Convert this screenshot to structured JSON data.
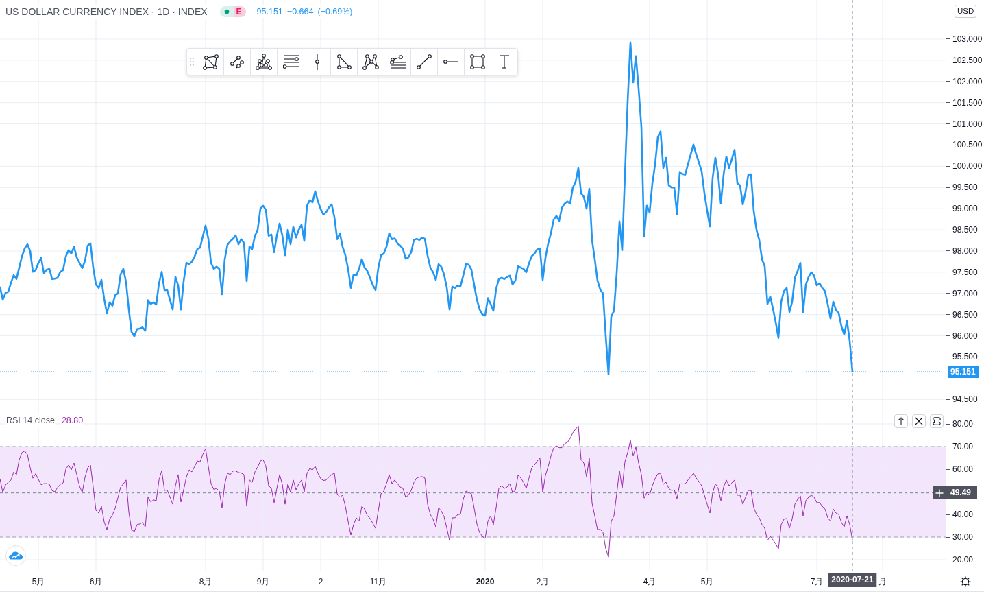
{
  "legend": {
    "title": "US DOLLAR CURRENCY INDEX · 1D · INDEX",
    "badge": "E",
    "last": "95.151",
    "change": "−0.664",
    "change_pct": "(−0.69%)"
  },
  "currency": "USD",
  "price_chart": {
    "chart_data": {
      "type": "line",
      "grid": true,
      "ylim": [
        94.278,
        103.922
      ],
      "yticks": [
        {
          "value": 94.5,
          "label": "94.500"
        },
        {
          "value": 95.5,
          "label": "95.500"
        },
        {
          "value": 96,
          "label": "96.000"
        },
        {
          "value": 96.5,
          "label": "96.500"
        },
        {
          "value": 97,
          "label": "97.000"
        },
        {
          "value": 97.5,
          "label": "97.500"
        },
        {
          "value": 98,
          "label": "98.000"
        },
        {
          "value": 98.5,
          "label": "98.500"
        },
        {
          "value": 99,
          "label": "99.000"
        },
        {
          "value": 99.5,
          "label": "99.500"
        },
        {
          "value": 100,
          "label": "100.000"
        },
        {
          "value": 100.5,
          "label": "100.500"
        },
        {
          "value": 101,
          "label": "101.000"
        },
        {
          "value": 101.5,
          "label": "101.500"
        },
        {
          "value": 102,
          "label": "102.000"
        },
        {
          "value": 102.5,
          "label": "102.500"
        },
        {
          "value": 103,
          "label": "103.000"
        }
      ],
      "categories": [
        null,
        null,
        null,
        null,
        null,
        null,
        null,
        null,
        null,
        null,
        null,
        null,
        null,
        null,
        null,
        null,
        null,
        null,
        null,
        null,
        null,
        null,
        null,
        null,
        null,
        null,
        null,
        null,
        null,
        null,
        null,
        null,
        null,
        null,
        null,
        null,
        null,
        null,
        null,
        null,
        null,
        null,
        null,
        null,
        null,
        null,
        null,
        null,
        null,
        null,
        null,
        null,
        null,
        null,
        null,
        null,
        null,
        null,
        null,
        null,
        null,
        null,
        null,
        null,
        null,
        null,
        null,
        null,
        null,
        null,
        null,
        null,
        null,
        null,
        null,
        null,
        null,
        null,
        null,
        null,
        null,
        null,
        null,
        null,
        null,
        null,
        null,
        null,
        null,
        null,
        null,
        null,
        null,
        null,
        null,
        null,
        null,
        null,
        null,
        null,
        null,
        null,
        null,
        null,
        null,
        null,
        null,
        null,
        null,
        null,
        null,
        null,
        null,
        null,
        null,
        null,
        null,
        null,
        null,
        null,
        null,
        null,
        null,
        null,
        null,
        null,
        null,
        null,
        null,
        null,
        null,
        null,
        null,
        null,
        null,
        null,
        null,
        null,
        null,
        null,
        null,
        null,
        null,
        null,
        null,
        null,
        null,
        null,
        null,
        null,
        null,
        null,
        null,
        null,
        null,
        null,
        null,
        null,
        null,
        null,
        null,
        null,
        null,
        null,
        null,
        null,
        null,
        null,
        null,
        null,
        null,
        null,
        null,
        null,
        null,
        null,
        null,
        null,
        null,
        null,
        null,
        null,
        null,
        null,
        null,
        null,
        null,
        null,
        null,
        null,
        null,
        null,
        null,
        null,
        null,
        null,
        null,
        null,
        null,
        null,
        null,
        null,
        null,
        null,
        null,
        null,
        null,
        null,
        null,
        null,
        null,
        null,
        null,
        null,
        null,
        null,
        null,
        null,
        null,
        null,
        null,
        null,
        null,
        null,
        null,
        null,
        null,
        null,
        null,
        null,
        null,
        null,
        null,
        null,
        null,
        null,
        null,
        null,
        null,
        null,
        null,
        null,
        null,
        null,
        null,
        null,
        null,
        null,
        null,
        null,
        null,
        null,
        null,
        null,
        null,
        null,
        null,
        null,
        null,
        null,
        null,
        null,
        null,
        null,
        null,
        null,
        null,
        null,
        null,
        null,
        null,
        null,
        null,
        null,
        null,
        null,
        null,
        null,
        null,
        null,
        null,
        null,
        null,
        null,
        null,
        null,
        null,
        null,
        null,
        null,
        null,
        null,
        null,
        null,
        null,
        null,
        null,
        null,
        null,
        null,
        null,
        null,
        null,
        null,
        null,
        null,
        null,
        null,
        null,
        null,
        null,
        null,
        null,
        null,
        null,
        null,
        null,
        null,
        null,
        null,
        null,
        null,
        null,
        null,
        null,
        null,
        null,
        null,
        null,
        null,
        null,
        null,
        null,
        null,
        null,
        null,
        null,
        null,
        null,
        null,
        null,
        null,
        null,
        null,
        null,
        null
      ],
      "series": [
        {
          "color": "#2196f3",
          "values": [
            97.16,
            96.85,
            97.01,
            97.04,
            97.25,
            97.43,
            97.34,
            97.61,
            97.87,
            98.06,
            98.16,
            98.0,
            97.51,
            97.55,
            97.72,
            97.84,
            97.48,
            97.56,
            97.58,
            97.34,
            97.35,
            97.37,
            97.51,
            97.55,
            97.87,
            98.02,
            97.94,
            98.1,
            97.85,
            97.72,
            97.6,
            97.77,
            98.13,
            98.18,
            97.61,
            97.21,
            97.13,
            97.32,
            96.87,
            96.53,
            96.79,
            96.71,
            96.96,
            97.0,
            97.45,
            97.58,
            97.26,
            96.62,
            96.09,
            95.99,
            96.16,
            96.17,
            96.2,
            96.12,
            96.84,
            96.75,
            96.79,
            96.74,
            97.24,
            97.51,
            97.08,
            97.08,
            96.85,
            96.62,
            97.39,
            97.19,
            96.62,
            97.29,
            97.72,
            97.69,
            97.75,
            97.87,
            98.05,
            98.08,
            98.35,
            98.6,
            98.29,
            97.72,
            97.58,
            97.63,
            97.58,
            96.98,
            97.81,
            98.15,
            98.23,
            98.29,
            98.37,
            98.16,
            98.28,
            98.19,
            97.29,
            98.1,
            98.05,
            98.36,
            98.5,
            99.0,
            99.07,
            98.97,
            98.36,
            98.39,
            97.97,
            98.37,
            98.65,
            98.37,
            97.9,
            98.5,
            98.16,
            98.57,
            98.32,
            98.5,
            98.62,
            98.24,
            99.07,
            99.2,
            99.15,
            99.41,
            99.17,
            98.99,
            98.86,
            98.92,
            99.03,
            99.1,
            98.8,
            98.28,
            98.42,
            98.1,
            97.9,
            97.58,
            97.13,
            97.45,
            97.42,
            97.58,
            97.81,
            97.61,
            97.53,
            97.37,
            97.2,
            97.08,
            97.6,
            97.9,
            97.94,
            98.1,
            98.42,
            98.28,
            98.3,
            98.18,
            98.13,
            98.05,
            97.82,
            97.85,
            97.97,
            98.26,
            98.29,
            98.26,
            98.32,
            98.29,
            97.89,
            97.61,
            97.5,
            97.32,
            97.69,
            97.63,
            97.45,
            97.14,
            96.62,
            97.16,
            97.13,
            97.19,
            97.17,
            97.42,
            97.69,
            97.68,
            97.56,
            97.2,
            96.85,
            96.62,
            96.5,
            96.48,
            96.89,
            96.75,
            96.59,
            97.11,
            97.34,
            97.37,
            97.34,
            97.39,
            97.42,
            97.21,
            97.3,
            97.64,
            97.61,
            97.58,
            97.5,
            97.71,
            97.88,
            97.94,
            98.04,
            98.05,
            97.32,
            97.84,
            98.18,
            98.42,
            98.74,
            98.83,
            98.71,
            99.02,
            99.12,
            99.17,
            99.12,
            99.5,
            99.63,
            99.96,
            99.36,
            99.28,
            99.0,
            99.47,
            98.26,
            97.8,
            97.3,
            97.09,
            97.0,
            95.99,
            95.09,
            96.45,
            96.59,
            97.48,
            98.7,
            98.02,
            99.8,
            101.53,
            102.92,
            101.98,
            102.6,
            101.82,
            100.93,
            98.34,
            99.07,
            98.91,
            99.59,
            100.04,
            100.69,
            100.82,
            99.96,
            100.2,
            99.55,
            99.5,
            99.5,
            98.87,
            99.85,
            99.82,
            99.8,
            100.05,
            100.28,
            100.51,
            100.28,
            100.09,
            99.88,
            99.36,
            98.95,
            98.58,
            99.73,
            100.2,
            99.8,
            99.12,
            99.8,
            100.23,
            99.96,
            100.17,
            100.39,
            99.6,
            99.55,
            99.1,
            99.39,
            99.8,
            99.81,
            98.94,
            98.5,
            98.26,
            97.81,
            97.64,
            96.75,
            96.93,
            96.64,
            96.32,
            95.95,
            96.8,
            97.05,
            97.13,
            96.56,
            96.8,
            97.37,
            97.53,
            97.72,
            96.56,
            97.21,
            97.39,
            97.5,
            97.42,
            97.19,
            97.24,
            97.13,
            97.05,
            96.74,
            96.41,
            96.8,
            96.61,
            96.53,
            96.22,
            96.03,
            96.35,
            95.88,
            95.15,
            null,
            null,
            null,
            null,
            null,
            null,
            null,
            null,
            null,
            null,
            null,
            null,
            null,
            null,
            null,
            null,
            null,
            null,
            null,
            null,
            null,
            null,
            null,
            null,
            null,
            null,
            null,
            null,
            null,
            null,
            null,
            null,
            null,
            null
          ]
        }
      ],
      "ref_lines": [
        {
          "axis": "y",
          "value": 95.151,
          "label": "95.151"
        }
      ]
    }
  },
  "rsi": {
    "label": "RSI 14 close",
    "value": "28.80",
    "chart_data": {
      "type": "line",
      "grid": true,
      "ylim": [
        15.152,
        86.364
      ],
      "yticks": [
        {
          "value": 20,
          "label": "20.00"
        },
        {
          "value": 30,
          "label": "30.00"
        },
        {
          "value": 40,
          "label": "40.00"
        },
        {
          "value": 60,
          "label": "60.00"
        },
        {
          "value": 70,
          "label": "70.00"
        },
        {
          "value": 80,
          "label": "80.00"
        }
      ],
      "categories": [
        null,
        null,
        null,
        null,
        null,
        null,
        null,
        null,
        null,
        null,
        null,
        null,
        null,
        null,
        "5月",
        null,
        null,
        null,
        null,
        null,
        null,
        null,
        null,
        null,
        null,
        null,
        null,
        null,
        null,
        null,
        null,
        null,
        null,
        null,
        null,
        "6月",
        null,
        null,
        null,
        null,
        null,
        null,
        null,
        null,
        null,
        null,
        null,
        null,
        null,
        null,
        null,
        null,
        null,
        null,
        null,
        null,
        null,
        null,
        null,
        null,
        null,
        null,
        null,
        null,
        null,
        null,
        null,
        null,
        null,
        null,
        null,
        null,
        null,
        null,
        null,
        "8月",
        null,
        null,
        null,
        null,
        null,
        null,
        null,
        null,
        null,
        null,
        null,
        null,
        null,
        null,
        null,
        null,
        null,
        null,
        null,
        null,
        "9月",
        null,
        null,
        null,
        null,
        null,
        null,
        null,
        null,
        null,
        null,
        null,
        null,
        null,
        null,
        null,
        null,
        null,
        null,
        null,
        null,
        "2",
        null,
        null,
        null,
        null,
        null,
        null,
        null,
        null,
        null,
        null,
        null,
        null,
        null,
        null,
        null,
        null,
        null,
        null,
        null,
        null,
        "11月",
        null,
        null,
        null,
        null,
        null,
        null,
        null,
        null,
        null,
        null,
        null,
        null,
        null,
        null,
        null,
        null,
        null,
        null,
        null,
        null,
        null,
        null,
        null,
        null,
        null,
        null,
        null,
        null,
        null,
        null,
        null,
        null,
        null,
        null,
        null,
        null,
        null,
        null,
        "2020",
        null,
        null,
        null,
        null,
        null,
        null,
        null,
        null,
        null,
        null,
        null,
        null,
        null,
        null,
        null,
        null,
        null,
        null,
        null,
        null,
        "2月",
        null,
        null,
        null,
        null,
        null,
        null,
        null,
        null,
        null,
        null,
        null,
        null,
        null,
        null,
        null,
        null,
        null,
        null,
        null,
        null,
        null,
        null,
        null,
        null,
        null,
        null,
        null,
        null,
        null,
        null,
        null,
        null,
        null,
        null,
        null,
        null,
        null,
        null,
        "4月",
        null,
        null,
        null,
        null,
        null,
        null,
        null,
        null,
        null,
        null,
        null,
        null,
        null,
        null,
        null,
        null,
        null,
        null,
        null,
        null,
        "5月",
        null,
        null,
        null,
        null,
        null,
        null,
        null,
        null,
        null,
        null,
        null,
        null,
        null,
        null,
        null,
        null,
        null,
        null,
        null,
        null,
        null,
        null,
        null,
        null,
        null,
        null,
        null,
        null,
        null,
        null,
        null,
        null,
        null,
        null,
        null,
        null,
        null,
        null,
        null,
        "7月",
        null,
        null,
        null,
        null,
        null,
        null,
        null,
        null,
        null,
        null,
        null,
        null,
        null,
        null,
        null,
        null,
        null,
        null,
        null,
        null,
        null,
        null,
        null,
        "月",
        null,
        null,
        null,
        null,
        null,
        null,
        null,
        null,
        null,
        null,
        null,
        null,
        null,
        null,
        null,
        null,
        null,
        null,
        null,
        null,
        null,
        null,
        null
      ],
      "series": [
        {
          "color": "#9c27b0",
          "values": [
            55.8,
            49.7,
            53.0,
            54.2,
            55.2,
            58.8,
            57.6,
            64.2,
            67.3,
            68.0,
            66.5,
            60.7,
            56.0,
            58.0,
            55.5,
            53.1,
            53.6,
            53.6,
            53.3,
            50.5,
            50.0,
            51.9,
            53.3,
            53.9,
            60.0,
            61.8,
            59.7,
            62.7,
            57.6,
            52.5,
            49.7,
            56.4,
            60.6,
            61.8,
            52.1,
            41.8,
            40.6,
            43.6,
            36.7,
            33.3,
            37.9,
            39.7,
            42.7,
            47.3,
            52.1,
            53.5,
            55.2,
            41.0,
            33.3,
            32.4,
            35.5,
            35.8,
            36.4,
            34.5,
            47.6,
            45.5,
            46.4,
            46.1,
            55.2,
            59.4,
            50.6,
            50.8,
            47.7,
            44.5,
            52.7,
            57.6,
            45.5,
            50.9,
            56.6,
            59.7,
            58.8,
            61.2,
            63.6,
            63.3,
            66.5,
            69.1,
            61.2,
            53.6,
            51.0,
            51.5,
            50.3,
            43.0,
            53.6,
            58.2,
            57.6,
            59.2,
            59.2,
            58.5,
            58.3,
            57.6,
            43.6,
            55.2,
            54.2,
            58.8,
            60.9,
            63.6,
            64.2,
            61.2,
            52.7,
            51.5,
            45.2,
            51.5,
            57.6,
            53.3,
            44.5,
            53.6,
            49.7,
            55.2,
            50.9,
            53.6,
            55.2,
            50.0,
            58.2,
            60.3,
            59.7,
            61.2,
            58.2,
            55.8,
            55.0,
            55.2,
            56.5,
            57.6,
            58.2,
            49.1,
            47.6,
            48.5,
            43.6,
            37.0,
            30.9,
            35.5,
            38.5,
            37.0,
            43.6,
            42.4,
            39.4,
            38.3,
            36.1,
            33.9,
            41.5,
            49.1,
            50.3,
            53.6,
            57.6,
            53.6,
            55.2,
            53.6,
            52.1,
            51.5,
            47.6,
            48.5,
            50.6,
            54.1,
            56.1,
            56.5,
            56.7,
            56.1,
            44.5,
            40.0,
            37.9,
            34.5,
            43.0,
            41.5,
            39.0,
            34.0,
            28.5,
            38.5,
            38.5,
            40.0,
            40.0,
            46.7,
            50.3,
            49.7,
            49.1,
            42.7,
            35.8,
            31.9,
            30.3,
            29.4,
            37.0,
            39.4,
            35.5,
            43.0,
            51.5,
            52.7,
            51.5,
            52.1,
            53.6,
            49.7,
            50.6,
            57.3,
            56.1,
            54.2,
            51.5,
            56.1,
            60.6,
            61.8,
            63.6,
            64.8,
            49.7,
            57.3,
            61.2,
            65.8,
            69.4,
            70.3,
            69.5,
            69.5,
            71.3,
            71.8,
            73.6,
            76.1,
            77.7,
            79.1,
            64.2,
            62.7,
            56.7,
            64.8,
            45.0,
            39.3,
            33.2,
            33.5,
            32.0,
            24.8,
            21.2,
            37.0,
            39.4,
            49.1,
            59.4,
            51.5,
            63.3,
            67.3,
            72.7,
            65.8,
            69.7,
            62.7,
            57.6,
            47.2,
            49.7,
            48.5,
            52.7,
            55.8,
            57.9,
            58.2,
            53.3,
            54.2,
            51.5,
            50.6,
            50.9,
            47.0,
            53.5,
            53.5,
            53.5,
            55.2,
            56.7,
            58.2,
            56.1,
            54.5,
            52.7,
            48.5,
            44.5,
            40.6,
            49.6,
            53.6,
            51.5,
            46.1,
            52.1,
            55.2,
            52.7,
            53.9,
            55.2,
            48.5,
            48.5,
            44.5,
            47.6,
            50.6,
            50.6,
            43.0,
            40.0,
            38.5,
            35.5,
            33.9,
            28.5,
            30.3,
            28.8,
            27.0,
            24.8,
            35.5,
            37.9,
            38.2,
            33.9,
            38.0,
            44.5,
            46.7,
            48.2,
            39.4,
            46.1,
            47.6,
            48.5,
            47.6,
            45.2,
            45.2,
            43.6,
            42.4,
            38.5,
            37.0,
            42.4,
            40.6,
            40.0,
            36.4,
            34.5,
            39.4,
            35.5,
            28.8,
            null,
            null,
            null,
            null,
            null,
            null,
            null,
            null,
            null,
            null,
            null,
            null,
            null,
            null,
            null,
            null,
            null,
            null,
            null,
            null,
            null,
            null,
            null,
            null,
            null,
            null,
            null,
            null,
            null,
            null,
            null,
            null,
            null,
            null
          ]
        }
      ],
      "bands": [
        {
          "axis": "y",
          "from": 30,
          "to": 70
        }
      ],
      "ref_lines": [
        {
          "axis": "y",
          "value": 49.49,
          "label": "49.49"
        }
      ]
    }
  },
  "crosshair": {
    "date": "2020-07-21"
  },
  "time_axis": {
    "bold": [
      false,
      false,
      false,
      false,
      false,
      false,
      true,
      false,
      false,
      false,
      false,
      false
    ]
  }
}
